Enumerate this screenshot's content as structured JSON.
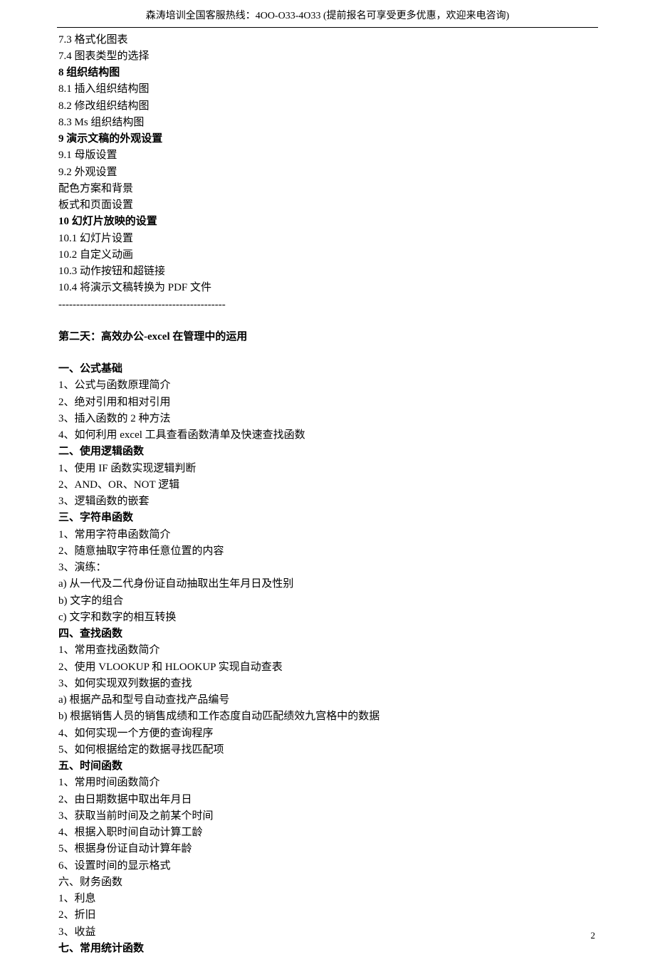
{
  "header": {
    "text": "森涛培训全国客服热线：4OO-O33-4O33 (提前报名可享受更多优惠，欢迎来电咨询)"
  },
  "page_number": "2",
  "lines": [
    {
      "text": "7.3 格式化图表",
      "bold": false
    },
    {
      "text": "7.4 图表类型的选择",
      "bold": false
    },
    {
      "text": "8 组织结构图",
      "bold": true
    },
    {
      "text": "8.1 插入组织结构图",
      "bold": false
    },
    {
      "text": "8.2 修改组织结构图",
      "bold": false
    },
    {
      "text": "8.3 Ms 组织结构图",
      "bold": false
    },
    {
      "text": "9 演示文稿的外观设置",
      "bold": true
    },
    {
      "text": "9.1 母版设置",
      "bold": false
    },
    {
      "text": "9.2 外观设置",
      "bold": false
    },
    {
      "text": "配色方案和背景",
      "bold": false
    },
    {
      "text": "板式和页面设置",
      "bold": false
    },
    {
      "text": "10 幻灯片放映的设置",
      "bold": true
    },
    {
      "text": "10.1 幻灯片设置",
      "bold": false
    },
    {
      "text": "10.2 自定义动画",
      "bold": false
    },
    {
      "text": "10.3 动作按钮和超链接",
      "bold": false
    },
    {
      "text": "10.4 将演示文稿转换为 PDF 文件",
      "bold": false
    },
    {
      "text": "-----------------------------------------------",
      "bold": false
    },
    {
      "text": "",
      "bold": false,
      "blank": true
    },
    {
      "text": "第二天：高效办公-excel 在管理中的运用",
      "bold": true
    },
    {
      "text": "",
      "bold": false,
      "blank": true
    },
    {
      "text": "一、公式基础",
      "bold": true
    },
    {
      "text": "1、公式与函数原理简介",
      "bold": false
    },
    {
      "text": "2、绝对引用和相对引用",
      "bold": false
    },
    {
      "text": "3、插入函数的 2 种方法",
      "bold": false
    },
    {
      "text": "4、如何利用 excel 工具查看函数清单及快速查找函数",
      "bold": false
    },
    {
      "text": "二、使用逻辑函数",
      "bold": true
    },
    {
      "text": "1、使用 IF 函数实现逻辑判断",
      "bold": false
    },
    {
      "text": "2、AND、OR、NOT 逻辑",
      "bold": false
    },
    {
      "text": "3、逻辑函数的嵌套",
      "bold": false
    },
    {
      "text": "三、字符串函数",
      "bold": true
    },
    {
      "text": "1、常用字符串函数简介",
      "bold": false
    },
    {
      "text": "2、随意抽取字符串任意位置的内容",
      "bold": false
    },
    {
      "text": "3、演练：",
      "bold": false
    },
    {
      "text": "a) 从一代及二代身份证自动抽取出生年月日及性别",
      "bold": false
    },
    {
      "text": "b) 文字的组合",
      "bold": false
    },
    {
      "text": "c) 文字和数字的相互转换",
      "bold": false
    },
    {
      "text": "四、查找函数",
      "bold": true
    },
    {
      "text": "1、常用查找函数简介",
      "bold": false
    },
    {
      "text": "2、使用 VLOOKUP 和 HLOOKUP 实现自动查表",
      "bold": false
    },
    {
      "text": "3、如何实现双列数据的查找",
      "bold": false
    },
    {
      "text": "a) 根据产品和型号自动查找产品编号",
      "bold": false
    },
    {
      "text": "b) 根据销售人员的销售成绩和工作态度自动匹配绩效九宫格中的数据",
      "bold": false
    },
    {
      "text": "4、如何实现一个方便的查询程序",
      "bold": false
    },
    {
      "text": "5、如何根据给定的数据寻找匹配项",
      "bold": false
    },
    {
      "text": "五、时间函数",
      "bold": true
    },
    {
      "text": "1、常用时间函数简介",
      "bold": false
    },
    {
      "text": "2、由日期数据中取出年月日",
      "bold": false
    },
    {
      "text": "3、获取当前时间及之前某个时间",
      "bold": false
    },
    {
      "text": "4、根据入职时间自动计算工龄",
      "bold": false
    },
    {
      "text": "5、根据身份证自动计算年龄",
      "bold": false
    },
    {
      "text": "6、设置时间的显示格式",
      "bold": false
    },
    {
      "text": "六、财务函数",
      "bold": false
    },
    {
      "text": "1、利息",
      "bold": false
    },
    {
      "text": "2、折旧",
      "bold": false
    },
    {
      "text": "3、收益",
      "bold": false
    },
    {
      "text": "七、常用统计函数",
      "bold": true
    }
  ]
}
